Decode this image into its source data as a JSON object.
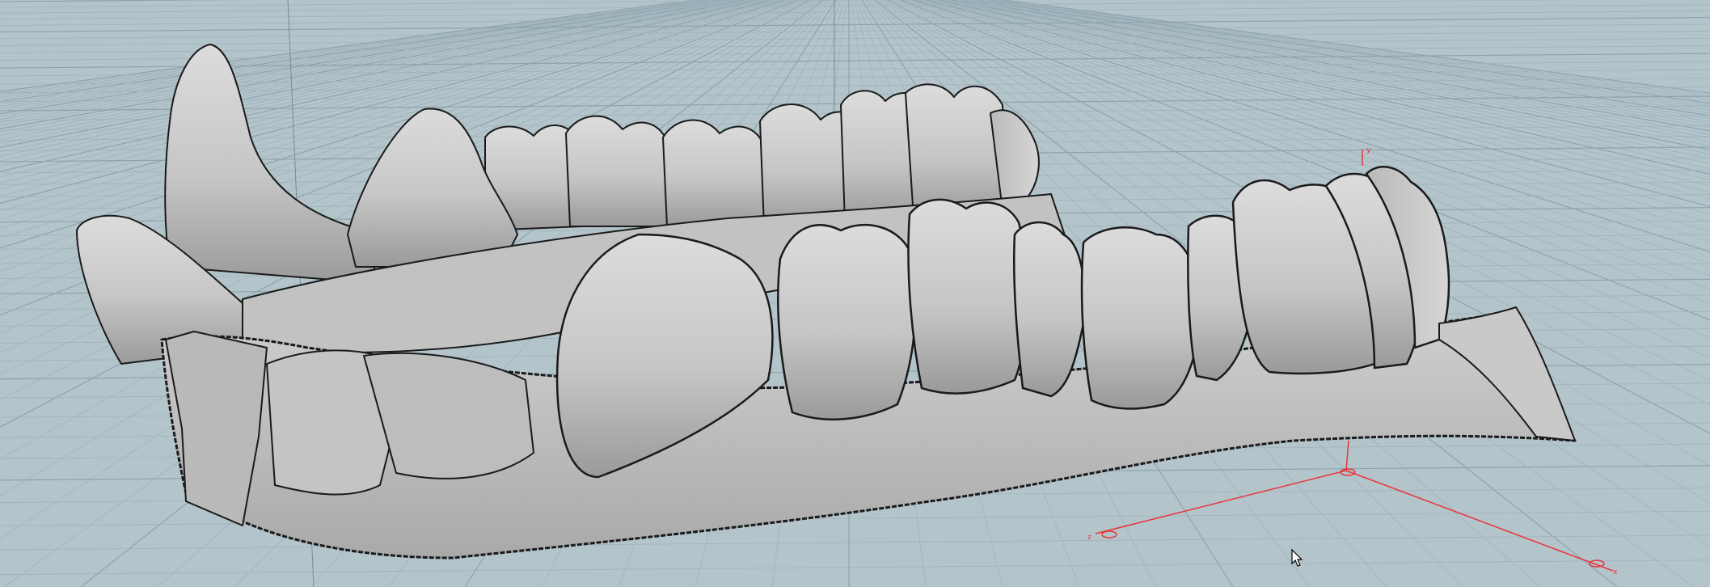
{
  "scene": {
    "background_color": "#b4c4cb",
    "grid_color": "#9fb2bb",
    "grid_major_color": "#8ea3ad",
    "model_color": "#c8c8c8",
    "model_shadow_color": "#8f8f8f",
    "outline_color": "#1a1a1a",
    "axis_color": "#e8353a",
    "guide_line_color": "#7c8a90"
  },
  "model": {
    "name": "mandible-jaw-mesh"
  },
  "gizmo": {
    "x_label": "x",
    "y_label": "y",
    "z_label": "z"
  },
  "cursor": {
    "icon": "arrow-pointer-icon"
  }
}
